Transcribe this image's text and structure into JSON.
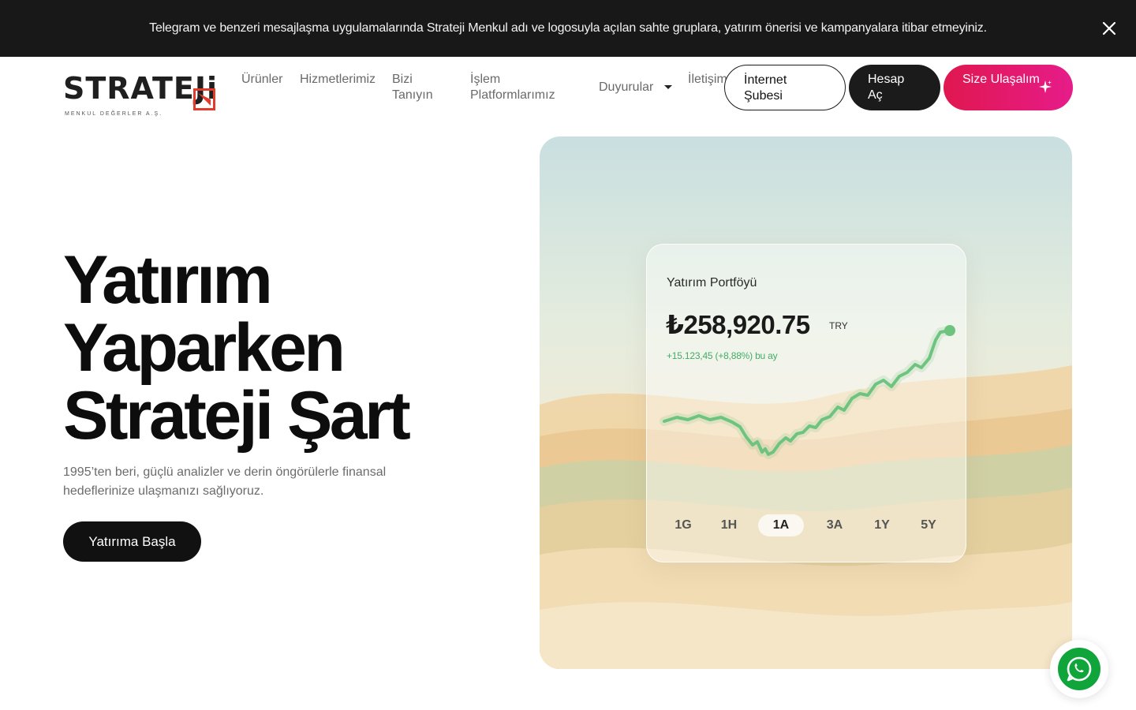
{
  "announcement": {
    "text": "Telegram ve benzeri mesajlaşma uygulamalarında Strateji Menkul adı ve logosuyla açılan sahte gruplara, yatırım önerisi ve kampanyalara itibar etmeyiniz.",
    "close_icon": "close-icon"
  },
  "logo": {
    "word": "STRATEJi",
    "subtitle": "MENKUL DEĞERLER A.Ş.",
    "accent": "#e23b2a"
  },
  "nav": {
    "items": [
      {
        "label": "Ürünler"
      },
      {
        "label": "Hizmetlerimiz"
      },
      {
        "label": "Bizi Tanıyın"
      },
      {
        "label": "İşlem Platformlarımız"
      },
      {
        "label": "Duyurular",
        "icon": "caret-down-icon"
      },
      {
        "label": "İletişim"
      }
    ]
  },
  "buttons": {
    "internet": "İnternet Şubesi",
    "hesap": "Hesap Aç",
    "size": "Size Ulaşalım",
    "size_icon": "sparkle-icon",
    "pink": "#e0174f"
  },
  "hero": {
    "title_lines": [
      "Yatırım",
      "Yaparken",
      "Strateji Şart"
    ],
    "description": "1995’ten beri, güçlü analizler ve derin öngörülerle finansal hedeflerinize ulaşmanızı sağlıyoruz.",
    "cta": "Yatırıma Başla"
  },
  "portfolio": {
    "title": "Yatırım Portföyü",
    "value": "₺258,920.75",
    "currency": "TRY",
    "change": "+15.123,45 (+8,88%) bu ay",
    "line_color": "#6ec47f",
    "ranges": [
      "1G",
      "1H",
      "1A",
      "3A",
      "1Y",
      "5Y"
    ],
    "active_range": "1A"
  },
  "whatsapp": {
    "icon": "whatsapp-icon",
    "color": "#0fa53b"
  }
}
